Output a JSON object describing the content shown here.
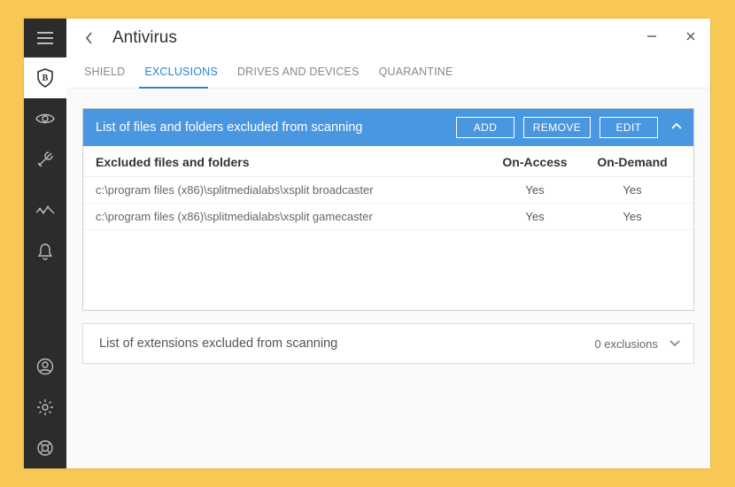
{
  "header": {
    "title": "Antivirus"
  },
  "tabs": {
    "items": [
      {
        "label": "SHIELD"
      },
      {
        "label": "EXCLUSIONS"
      },
      {
        "label": "DRIVES AND DEVICES"
      },
      {
        "label": "QUARANTINE"
      }
    ],
    "active_index": 1
  },
  "panel1": {
    "title": "List of files and folders excluded from scanning",
    "add_label": "ADD",
    "remove_label": "REMOVE",
    "edit_label": "EDIT",
    "columns": {
      "path": "Excluded files and folders",
      "access": "On-Access",
      "demand": "On-Demand"
    },
    "rows": [
      {
        "path": "c:\\program files (x86)\\splitmedialabs\\xsplit broadcaster",
        "access": "Yes",
        "demand": "Yes"
      },
      {
        "path": "c:\\program files (x86)\\splitmedialabs\\xsplit gamecaster",
        "access": "Yes",
        "demand": "Yes"
      }
    ]
  },
  "panel2": {
    "title": "List of extensions excluded from scanning",
    "count_label": "0 exclusions"
  }
}
